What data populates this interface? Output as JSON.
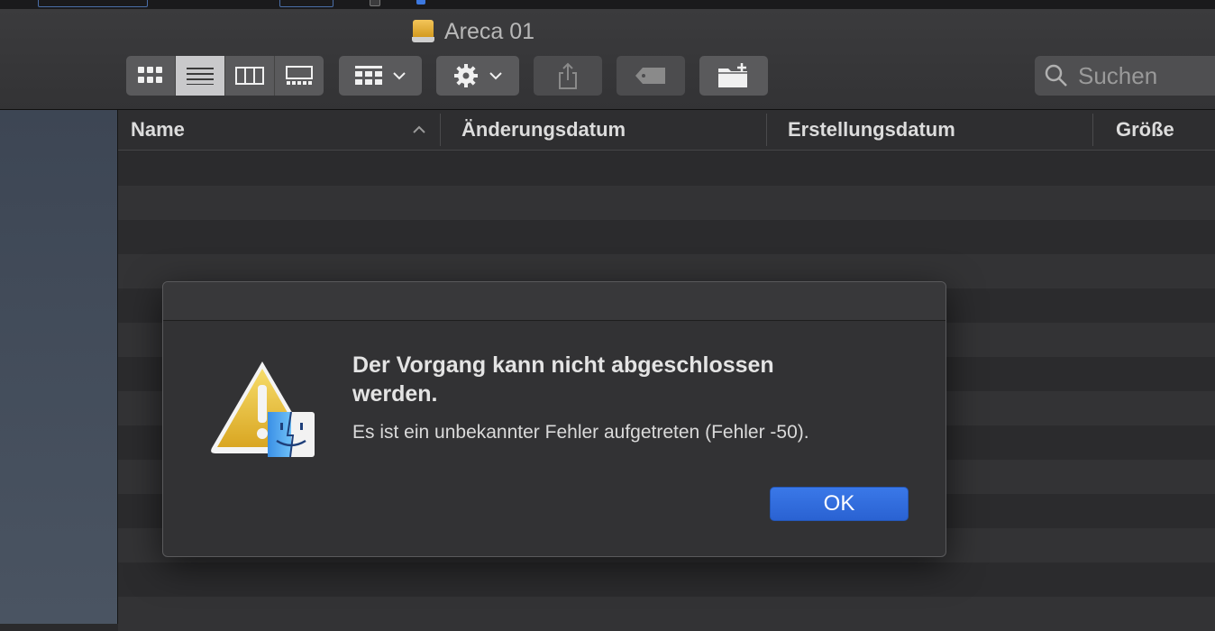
{
  "window": {
    "title": "Areca 01"
  },
  "toolbar": {
    "view_modes": [
      "icon-view",
      "list-view",
      "column-view",
      "gallery-view"
    ],
    "active_view": "list-view"
  },
  "search": {
    "placeholder": "Suchen"
  },
  "list": {
    "columns": [
      "Name",
      "Änderungsdatum",
      "Erstellungsdatum",
      "Größe"
    ],
    "sort_column": "Name",
    "sort_direction": "ascending"
  },
  "dialog": {
    "heading": "Der Vorgang kann nicht abgeschlossen werden.",
    "message": "Es ist ein unbekannter Fehler aufgetreten (Fehler -50).",
    "ok_label": "OK"
  },
  "colors": {
    "accent": "#2a62d2",
    "warning": "#e8b42a"
  }
}
